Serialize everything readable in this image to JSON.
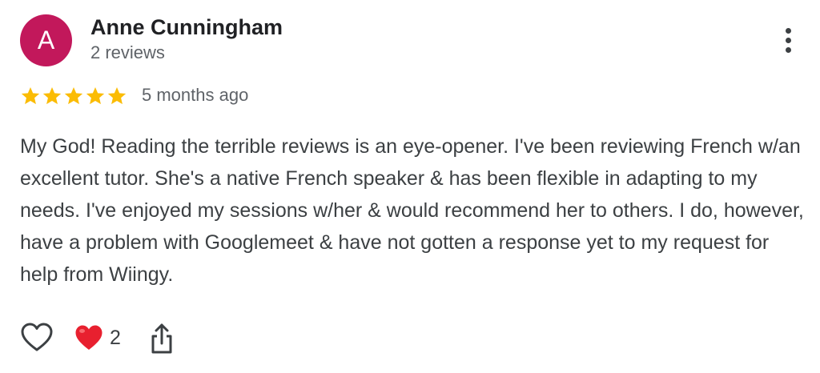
{
  "reviewer": {
    "initial": "A",
    "name": "Anne Cunningham",
    "review_count": "2 reviews",
    "avatar_color": "#c2185b"
  },
  "review": {
    "rating": 5,
    "rating_max": 5,
    "star_color": "#fbbc04",
    "time_ago": "5 months ago",
    "text": "My God! Reading the terrible reviews is an eye-opener. I've been reviewing French w/an excellent tutor. She's a native French speaker & has been flexible in adapting to my needs. I've enjoyed my sessions w/her & would recommend her to others. I do, however, have a problem with Googlemeet & have not gotten a response yet to my request for help from Wiingy."
  },
  "actions": {
    "like_icon": "heart-outline-icon",
    "reaction_icon": "red-heart-icon",
    "reaction_color": "#e8202f",
    "reaction_count": "2",
    "share_icon": "share-icon",
    "more_icon": "more-vert-icon"
  }
}
